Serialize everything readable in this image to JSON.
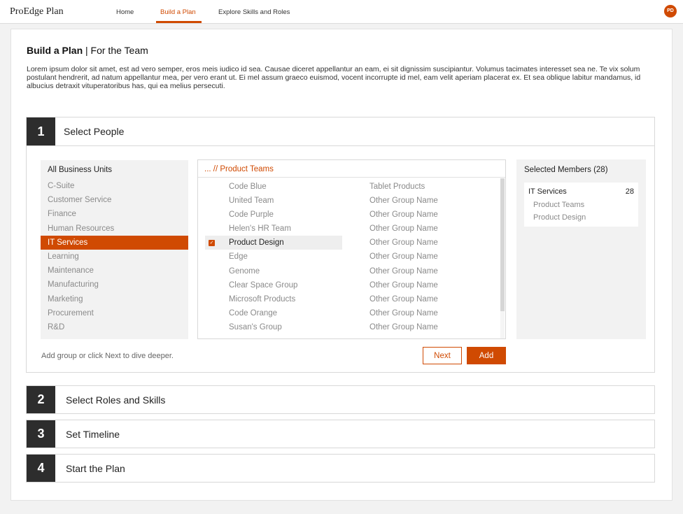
{
  "app": {
    "brand": "ProEdge Plan",
    "avatar_initials": "PD",
    "accent": "#d04a02"
  },
  "nav": {
    "items": [
      {
        "label": "Home"
      },
      {
        "label": "Build a Plan",
        "active": true
      },
      {
        "label": "Explore Skills and Roles"
      }
    ]
  },
  "page": {
    "title_bold": "Build a Plan",
    "title_rest": " | For the Team",
    "intro": "Lorem ipsum dolor sit amet, est ad vero semper, eros meis iudico id sea. Causae diceret appellantur an eam, ei sit dignissim suscipiantur. Volumus tacimates interesset sea ne. Te vix solum postulant hendrerit, ad natum appellantur mea, per vero erant ut. Ei mel assum graeco euismod, vocent incorrupte id mel, eam velit aperiam placerat ex. Et sea oblique labitur mandamus, id albucius detraxit vituperatoribus has, qui ea melius persecuti."
  },
  "step1": {
    "number": "1",
    "title": "Select People",
    "units_header": "All Business Units",
    "units": [
      "C-Suite",
      "Customer Service",
      "Finance",
      "Human Resources",
      "IT Services",
      "Learning",
      "Maintenance",
      "Manufacturing",
      "Marketing",
      "Procurement",
      "R&D"
    ],
    "selected_unit": "IT Services",
    "breadcrumb": "...  //  Product Teams",
    "groups": [
      {
        "name": "Code Blue",
        "group": "Tablet Products"
      },
      {
        "name": "United Team",
        "group": "Other Group Name"
      },
      {
        "name": "Code Purple",
        "group": "Other Group Name"
      },
      {
        "name": "Helen's HR Team",
        "group": "Other Group Name"
      },
      {
        "name": "Product Design",
        "group": "Other Group Name",
        "checked": true
      },
      {
        "name": "Edge",
        "group": "Other Group Name"
      },
      {
        "name": "Genome",
        "group": "Other Group Name"
      },
      {
        "name": "Clear Space Group",
        "group": "Other Group Name"
      },
      {
        "name": "Microsoft Products",
        "group": "Other Group Name"
      },
      {
        "name": "Code Orange",
        "group": "Other Group Name"
      },
      {
        "name": "Susan's Group",
        "group": "Other Group Name"
      }
    ],
    "selected_header": "Selected Members (28)",
    "selected": {
      "unit": "IT Services",
      "count": "28",
      "subs": [
        "Product Teams",
        "Product Design"
      ]
    },
    "hint": "Add group or click Next to dive deeper.",
    "next_label": "Next",
    "add_label": "Add"
  },
  "steps": [
    {
      "number": "2",
      "label": "Select Roles and Skills"
    },
    {
      "number": "3",
      "label": "Set Timeline"
    },
    {
      "number": "4",
      "label": "Start the Plan"
    }
  ]
}
